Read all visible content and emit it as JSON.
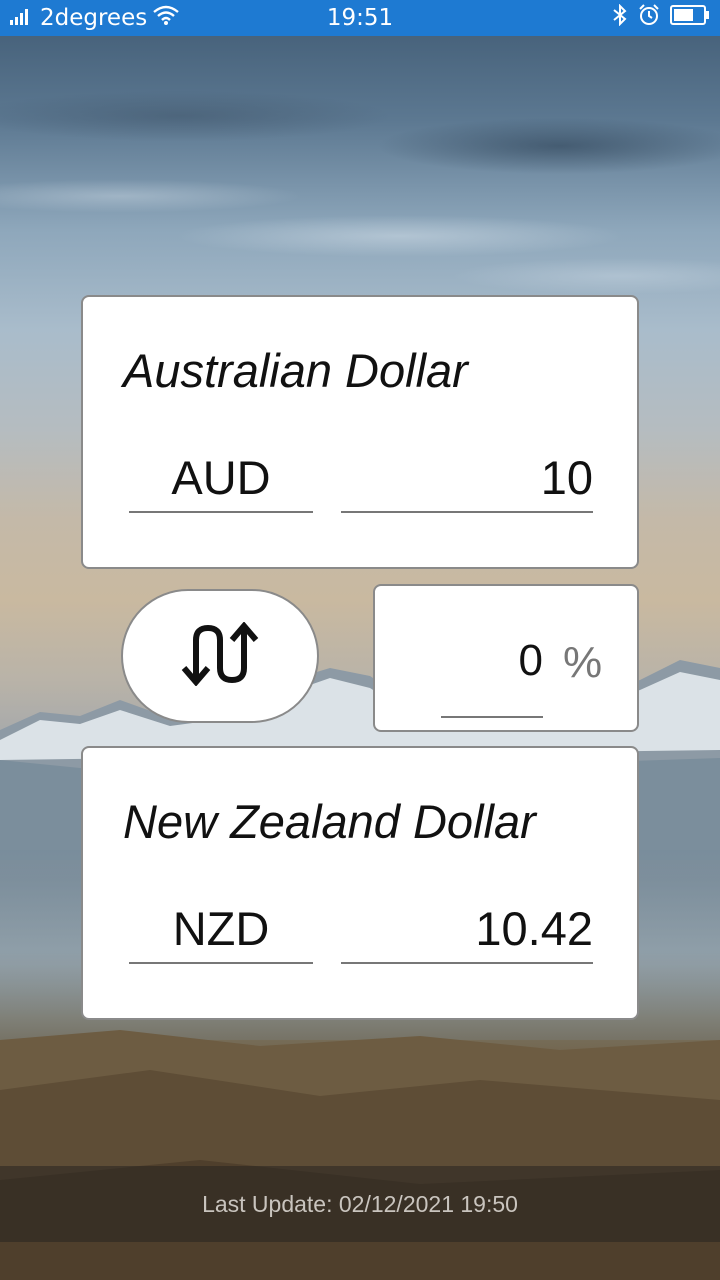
{
  "status_bar": {
    "carrier": "2degrees",
    "time": "19:51",
    "icons": [
      "signal-icon",
      "wifi-icon",
      "bluetooth-icon",
      "alarm-icon",
      "battery-icon"
    ],
    "bar_color": "#1e7ad2"
  },
  "from_currency": {
    "name": "Australian Dollar",
    "code": "AUD",
    "amount": "10"
  },
  "swap": {
    "icon": "swap-arrows-icon"
  },
  "fee": {
    "value": "0",
    "unit": "%"
  },
  "to_currency": {
    "name": "New Zealand Dollar",
    "code": "NZD",
    "amount": "10.42"
  },
  "footer": {
    "last_update": "Last Update: 02/12/2021 19:50"
  }
}
